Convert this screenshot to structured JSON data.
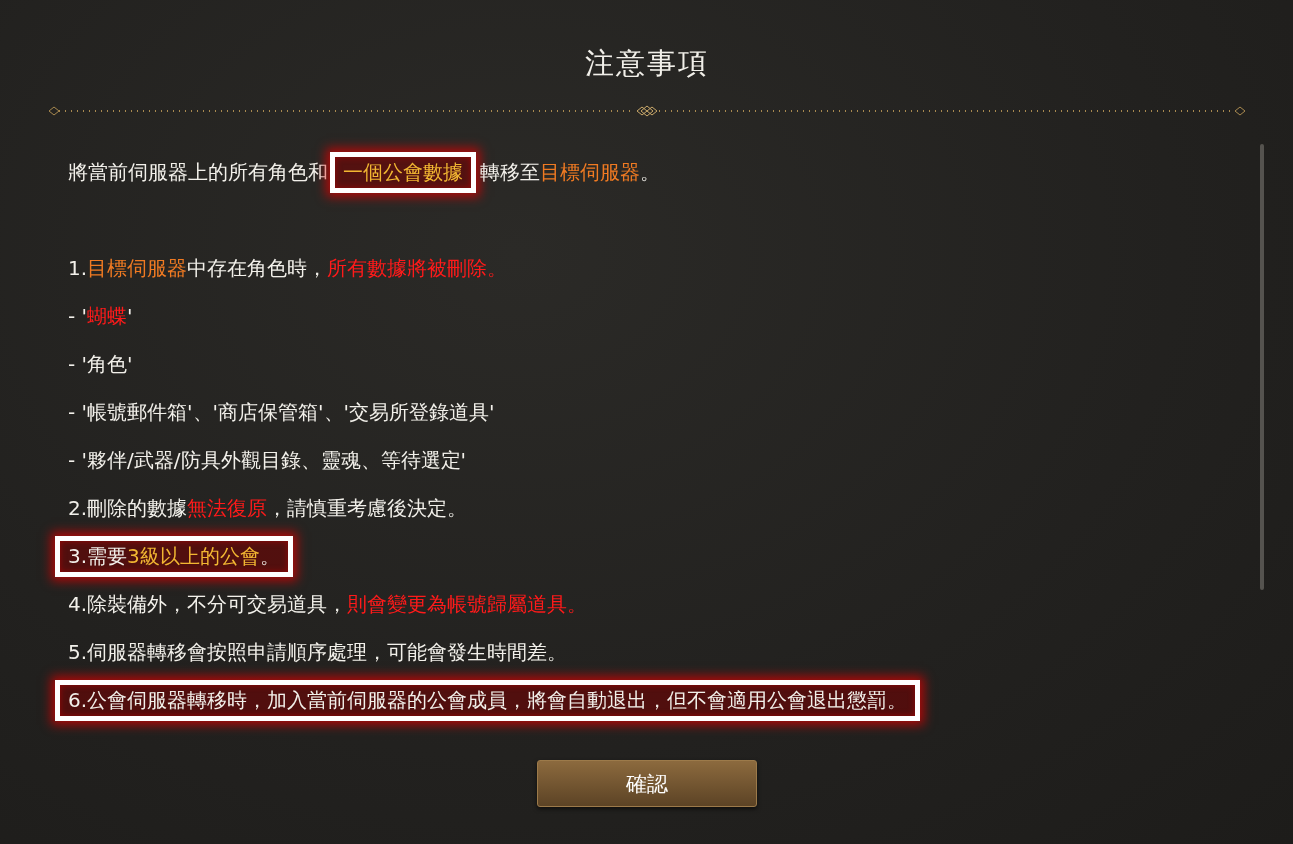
{
  "title": "注意事項",
  "intro": [
    {
      "highlighted": false,
      "segments": [
        {
          "text": "將當前伺服器上的所有角色和"
        }
      ]
    },
    {
      "highlighted": true,
      "segments": [
        {
          "text": "一個公會數據",
          "color": "#f2b732"
        }
      ]
    },
    {
      "highlighted": false,
      "segments": [
        {
          "text": "轉移至"
        },
        {
          "text": "目標伺服器",
          "color": "#f07a22"
        },
        {
          "text": "。"
        }
      ]
    }
  ],
  "notes": [
    {
      "highlighted": false,
      "segments": [
        {
          "text": "1."
        },
        {
          "text": "目標伺服器",
          "color": "#f07a22"
        },
        {
          "text": "中存在角色時，"
        },
        {
          "text": "所有數據將被刪除。",
          "color": "#ff1a1a"
        }
      ]
    },
    {
      "highlighted": false,
      "segments": [
        {
          "text": "- '"
        },
        {
          "text": "蝴蝶",
          "color": "#ff1a1a"
        },
        {
          "text": "'"
        }
      ]
    },
    {
      "highlighted": false,
      "segments": [
        {
          "text": "- '角色'"
        }
      ]
    },
    {
      "highlighted": false,
      "segments": [
        {
          "text": "- '帳號郵件箱'、'商店保管箱'、'交易所登錄道具'"
        }
      ]
    },
    {
      "highlighted": false,
      "segments": [
        {
          "text": "- '夥伴/武器/防具外觀目錄、靈魂、等待選定'"
        }
      ]
    },
    {
      "highlighted": false,
      "segments": [
        {
          "text": "2.刪除的數據"
        },
        {
          "text": "無法復原",
          "color": "#ff1a1a"
        },
        {
          "text": "，請慎重考慮後決定。"
        }
      ]
    },
    {
      "highlighted": true,
      "segments": [
        {
          "text": "3.需要"
        },
        {
          "text": "3級以上的公會",
          "color": "#f2b732"
        },
        {
          "text": "。"
        }
      ]
    },
    {
      "highlighted": false,
      "segments": [
        {
          "text": "4.除裝備外，不分可交易道具，"
        },
        {
          "text": "則會變更為帳號歸屬道具。",
          "color": "#ff1a1a"
        }
      ]
    },
    {
      "highlighted": false,
      "segments": [
        {
          "text": "5.伺服器轉移會按照申請順序處理，可能會發生時間差。"
        }
      ]
    },
    {
      "highlighted": true,
      "segments": [
        {
          "text": "6.公會伺服器轉移時，加入當前伺服器的公會成員，將會自動退出，但不會適用公會退出懲罰。"
        }
      ]
    }
  ],
  "confirm_button": "確認"
}
